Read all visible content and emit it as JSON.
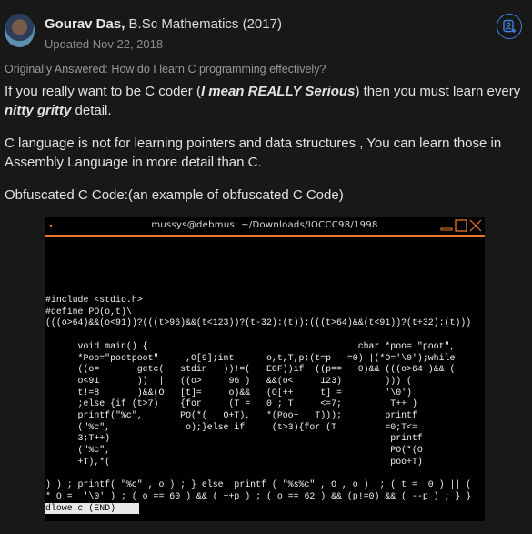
{
  "author": {
    "name": "Gourav Das",
    "credential": "B.Sc Mathematics (2017)",
    "updated": "Updated Nov 22, 2018"
  },
  "follow_icon": "person-add-icon",
  "originally_answered": "Originally Answered: How do I learn C programming effectively?",
  "body": {
    "p1_a": "If you really want to be C coder (",
    "p1_em": "I mean REALLY Serious",
    "p1_b": ") then you must learn every ",
    "p1_em2": "nitty gritty",
    "p1_c": " detail.",
    "p2": "C language is not for learning pointers and data structures , You can learn those in Assembly Language in more detail than C.",
    "p3": "Obfuscated C Code:(an example of obfuscated C Code)"
  },
  "terminal": {
    "title": "mussys@debmus: ~/Downloads/IOCCC98/1998",
    "accent": "#e9772a",
    "code": "#include <stdio.h>\n#define PO(o,t)\\\n(((o>64)&&(o<91))?(((t>96)&&(t<123))?(t-32):(t)):(((t>64)&&(t<91))?(t+32):(t)))\n\n      void main() {                                       char *poo= \"poot\",\n      *Poo=\"pootpoot\"     ,O[9];int      o,t,T,p;(t=p   =0)||(*O='\\0');while\n      ((o=       getc(   stdin   ))!=(   EOF))if  ((p==   0)&& (((o>64 )&& (\n      o<91       )) ||   ((o>     96 )   &&(o<     123)        ))) (\n      t!=8       )&&(O   [t]=     o)&&   (O[++     t] =        '\\0')\n      ;else {if (t>7)    {for     (T =   0 ; T     <=7;         T++ )\n      printf(\"%c\",       PO(*(   O+T),   *(Poo+   T)));        printf\n      (\"%c\",              o);}else if     (t>3){for (T         =0;T<=\n      3;T++)                                                    printf\n      (\"%c\",                                                    PO(*(O\n      +T),*(                                                    poo+T)\n\n) ) ; printf( \"%c\" , o ) ; } else  printf ( \"%s%c\" , O , o )  ; ( t =  0 ) || (\n* O =  '\\0' ) ; ( o == 60 ) && ( ++p ) ; ( o == 62 ) && (p!=0) && ( --p ) ; } }",
    "status": "dlowe.c (END)"
  }
}
